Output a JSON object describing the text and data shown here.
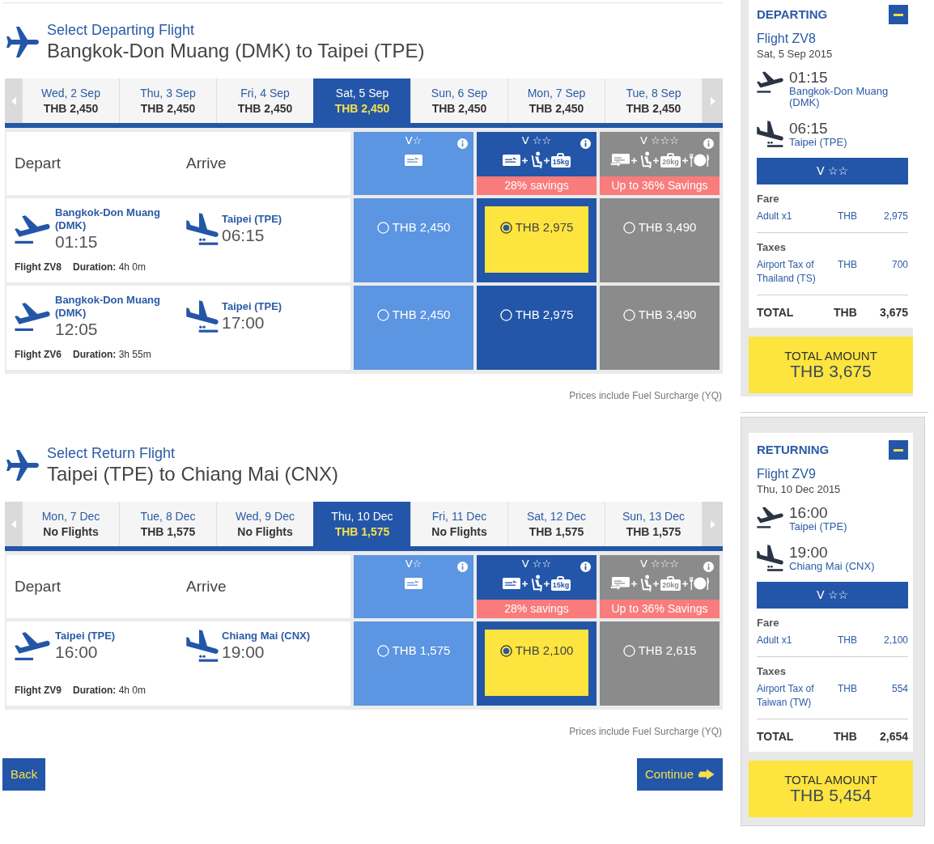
{
  "sections": [
    {
      "title": "Select Departing Flight",
      "route": "Bangkok-Don Muang (DMK) to Taipei (TPE)",
      "dates": [
        {
          "date": "Wed, 2 Sep",
          "price": "THB 2,450",
          "selected": false
        },
        {
          "date": "Thu, 3 Sep",
          "price": "THB 2,450",
          "selected": false
        },
        {
          "date": "Fri, 4 Sep",
          "price": "THB 2,450",
          "selected": false
        },
        {
          "date": "Sat, 5 Sep",
          "price": "THB 2,450",
          "selected": true
        },
        {
          "date": "Sun, 6 Sep",
          "price": "THB 2,450",
          "selected": false
        },
        {
          "date": "Mon, 7 Sep",
          "price": "THB 2,450",
          "selected": false
        },
        {
          "date": "Tue, 8 Sep",
          "price": "THB 2,450",
          "selected": false
        }
      ],
      "columns": [
        "Depart",
        "Arrive"
      ],
      "fare_classes": [
        {
          "label": "V☆",
          "color": "#5c95e1",
          "amenities": [
            {
              "kind": "ticket"
            }
          ]
        },
        {
          "label": "V ☆☆",
          "color": "#2356a8",
          "amenities": [
            {
              "kind": "ticket"
            },
            {
              "kind": "seat"
            },
            {
              "kind": "bag",
              "weight": "15kg"
            }
          ],
          "savings": "28% savings"
        },
        {
          "label": "V ☆☆☆",
          "color": "#8b8b8b",
          "amenities": [
            {
              "kind": "ticket_change"
            },
            {
              "kind": "seat"
            },
            {
              "kind": "bag",
              "weight": "20kg"
            },
            {
              "kind": "meal"
            }
          ],
          "savings": "Up to 36% Savings"
        }
      ],
      "flights": [
        {
          "depart_airport": "Bangkok-Don Muang (DMK)",
          "depart_time": "01:15",
          "arrive_airport": "Taipei (TPE)",
          "arrive_time": "06:15",
          "flight": "Flight ZV8",
          "duration": "**Duration:** 4h 0m",
          "fares": [
            {
              "price": "THB 2,450",
              "selected": false
            },
            {
              "price": "THB 2,975",
              "selected": true
            },
            {
              "price": "THB 3,490",
              "selected": false
            }
          ]
        },
        {
          "depart_airport": "Bangkok-Don Muang (DMK)",
          "depart_time": "12:05",
          "arrive_airport": "Taipei (TPE)",
          "arrive_time": "17:00",
          "flight": "Flight ZV6",
          "duration": "**Duration:** 3h 55m",
          "fares": [
            {
              "price": "THB 2,450",
              "selected": false
            },
            {
              "price": "THB 2,975",
              "selected": false
            },
            {
              "price": "THB 3,490",
              "selected": false
            }
          ]
        }
      ],
      "note": "Prices include Fuel Surcharge (YQ)"
    },
    {
      "title": "Select Return Flight",
      "route": "Taipei (TPE) to Chiang Mai (CNX)",
      "dates": [
        {
          "date": "Mon, 7 Dec",
          "price": "No Flights",
          "selected": false
        },
        {
          "date": "Tue, 8 Dec",
          "price": "THB 1,575",
          "selected": false
        },
        {
          "date": "Wed, 9 Dec",
          "price": "No Flights",
          "selected": false
        },
        {
          "date": "Thu, 10 Dec",
          "price": "THB 1,575",
          "selected": true
        },
        {
          "date": "Fri, 11 Dec",
          "price": "No Flights",
          "selected": false
        },
        {
          "date": "Sat, 12 Dec",
          "price": "THB 1,575",
          "selected": false
        },
        {
          "date": "Sun, 13 Dec",
          "price": "THB 1,575",
          "selected": false
        }
      ],
      "columns": [
        "Depart",
        "Arrive"
      ],
      "fare_classes": [
        {
          "label": "V☆",
          "color": "#5c95e1",
          "amenities": [
            {
              "kind": "ticket"
            }
          ]
        },
        {
          "label": "V ☆☆",
          "color": "#2356a8",
          "amenities": [
            {
              "kind": "ticket"
            },
            {
              "kind": "seat"
            },
            {
              "kind": "bag",
              "weight": "15kg"
            }
          ],
          "savings": "28% savings"
        },
        {
          "label": "V ☆☆☆",
          "color": "#8b8b8b",
          "amenities": [
            {
              "kind": "ticket_change"
            },
            {
              "kind": "seat"
            },
            {
              "kind": "bag",
              "weight": "20kg"
            },
            {
              "kind": "meal"
            }
          ],
          "savings": "Up to 36% Savings"
        }
      ],
      "flights": [
        {
          "depart_airport": "Taipei (TPE)",
          "depart_time": "16:00",
          "arrive_airport": "Chiang Mai (CNX)",
          "arrive_time": "19:00",
          "flight": "Flight ZV9",
          "duration": "**Duration:** 4h 0m",
          "fares": [
            {
              "price": "THB 1,575",
              "selected": false
            },
            {
              "price": "THB 2,100",
              "selected": true
            },
            {
              "price": "THB 2,615",
              "selected": false
            }
          ]
        }
      ],
      "note": "Prices include Fuel Surcharge (YQ)"
    }
  ],
  "buttons": [
    {
      "kind": "back",
      "label": "Back"
    },
    {
      "kind": "continue",
      "label": "Continue"
    }
  ],
  "summary": [
    {
      "heading": "DEPARTING",
      "expanded": true,
      "flight": "Flight ZV8",
      "date": "Sat, 5 Sep 2015",
      "depart_time": "01:15",
      "depart_airport": "Bangkok-Don Muang (DMK)",
      "arrive_time": "06:15",
      "arrive_airport": "Taipei (TPE)",
      "fare_class": "V ☆☆",
      "fare_heading": "Fare",
      "fare_lines": [
        {
          "label": "Adult x1",
          "currency": "THB",
          "amount": "2,975"
        }
      ],
      "taxes_heading": "Taxes",
      "tax_lines": [
        {
          "label": "Airport Tax of Thailand (TS)",
          "currency": "THB",
          "amount": "700"
        }
      ],
      "total_label": "TOTAL",
      "total_currency": "THB",
      "total_amount": "3,675",
      "grand_total_label": "TOTAL AMOUNT",
      "grand_total": "THB 3,675"
    },
    {
      "heading": "RETURNING",
      "expanded": true,
      "flight": "Flight ZV9",
      "date": "Thu, 10 Dec 2015",
      "depart_time": "16:00",
      "depart_airport": "Taipei (TPE)",
      "arrive_time": "19:00",
      "arrive_airport": "Chiang Mai (CNX)",
      "fare_class": "V ☆☆",
      "fare_heading": "Fare",
      "fare_lines": [
        {
          "label": "Adult x1",
          "currency": "THB",
          "amount": "2,100"
        }
      ],
      "taxes_heading": "Taxes",
      "tax_lines": [
        {
          "label": "Airport Tax of Taiwan (TW)",
          "currency": "THB",
          "amount": "554"
        }
      ],
      "total_label": "TOTAL",
      "total_currency": "THB",
      "total_amount": "2,654",
      "grand_total_label": "TOTAL AMOUNT",
      "grand_total": "THB 5,454"
    }
  ]
}
